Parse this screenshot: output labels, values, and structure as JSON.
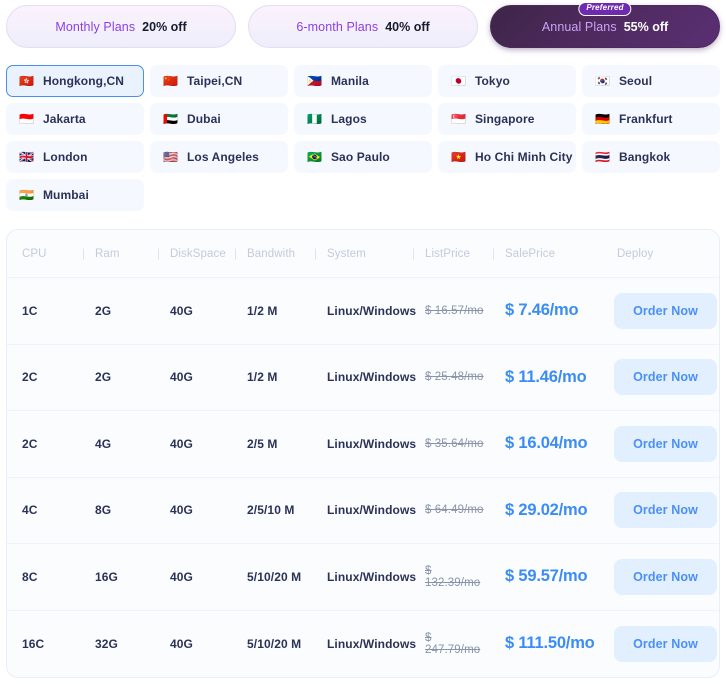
{
  "plan_tabs": [
    {
      "name": "Monthly Plans",
      "discount": "20% off",
      "active": false,
      "badge": null
    },
    {
      "name": "6-month Plans",
      "discount": "40% off",
      "active": false,
      "badge": null
    },
    {
      "name": "Annual Plans",
      "discount": "55% off",
      "active": true,
      "badge": "Preferred"
    }
  ],
  "locations": [
    {
      "flag": "🇭🇰",
      "label": "Hongkong,CN",
      "selected": true
    },
    {
      "flag": "🇨🇳",
      "label": "Taipei,CN",
      "selected": false
    },
    {
      "flag": "🇵🇭",
      "label": "Manila",
      "selected": false
    },
    {
      "flag": "🇯🇵",
      "label": "Tokyo",
      "selected": false
    },
    {
      "flag": "🇰🇷",
      "label": "Seoul",
      "selected": false
    },
    {
      "flag": "🇮🇩",
      "label": "Jakarta",
      "selected": false
    },
    {
      "flag": "🇦🇪",
      "label": "Dubai",
      "selected": false
    },
    {
      "flag": "🇳🇬",
      "label": "Lagos",
      "selected": false
    },
    {
      "flag": "🇸🇬",
      "label": "Singapore",
      "selected": false
    },
    {
      "flag": "🇩🇪",
      "label": "Frankfurt",
      "selected": false
    },
    {
      "flag": "🇬🇧",
      "label": "London",
      "selected": false
    },
    {
      "flag": "🇺🇸",
      "label": "Los Angeles",
      "selected": false
    },
    {
      "flag": "🇧🇷",
      "label": "Sao Paulo",
      "selected": false
    },
    {
      "flag": "🇻🇳",
      "label": "Ho Chi Minh City",
      "selected": false
    },
    {
      "flag": "🇹🇭",
      "label": "Bangkok",
      "selected": false
    },
    {
      "flag": "🇮🇳",
      "label": "Mumbai",
      "selected": false
    }
  ],
  "table": {
    "headers": [
      "CPU",
      "Ram",
      "DiskSpace",
      "Bandwith",
      "System",
      "ListPrice",
      "SalePrice",
      "Deploy"
    ],
    "order_button_label": "Order Now",
    "rows": [
      {
        "cpu": "1C",
        "ram": "2G",
        "disk": "40G",
        "bandwidth": "1/2 M",
        "system": "Linux/Windows",
        "list_price": "$ 16.57/mo",
        "sale_price": "$ 7.46/mo"
      },
      {
        "cpu": "2C",
        "ram": "2G",
        "disk": "40G",
        "bandwidth": "1/2 M",
        "system": "Linux/Windows",
        "list_price": "$ 25.48/mo",
        "sale_price": "$ 11.46/mo"
      },
      {
        "cpu": "2C",
        "ram": "4G",
        "disk": "40G",
        "bandwidth": "2/5 M",
        "system": "Linux/Windows",
        "list_price": "$ 35.64/mo",
        "sale_price": "$ 16.04/mo"
      },
      {
        "cpu": "4C",
        "ram": "8G",
        "disk": "40G",
        "bandwidth": "2/5/10 M",
        "system": "Linux/Windows",
        "list_price": "$ 64.49/mo",
        "sale_price": "$ 29.02/mo"
      },
      {
        "cpu": "8C",
        "ram": "16G",
        "disk": "40G",
        "bandwidth": "5/10/20 M",
        "system": "Linux/Windows",
        "list_price": "$ 132.39/mo",
        "sale_price": "$ 59.57/mo"
      },
      {
        "cpu": "16C",
        "ram": "32G",
        "disk": "40G",
        "bandwidth": "5/10/20 M",
        "system": "Linux/Windows",
        "list_price": "$ 247.79/mo",
        "sale_price": "$ 111.50/mo"
      }
    ]
  },
  "colors": {
    "accent_blue": "#3b8cf5",
    "accent_purple": "#8b3fe8",
    "active_tab_bg": "#4e2a5e",
    "order_btn_bg": "#e2effe",
    "selected_loc_border": "#4a8ef0"
  }
}
